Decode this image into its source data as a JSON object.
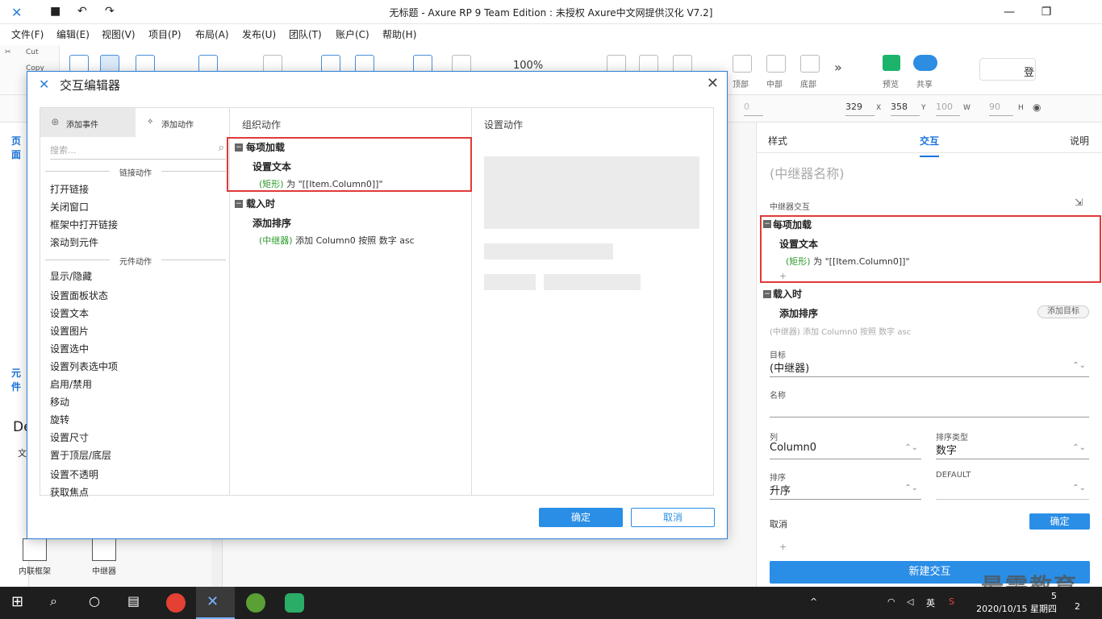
{
  "app": {
    "title": "无标题 - Axure RP 9 Team Edition : 未授权     Axure中文网提供汉化 V7.2]"
  },
  "menu": [
    "文件(F)",
    "编辑(E)",
    "视图(V)",
    "项目(P)",
    "布局(A)",
    "发布(U)",
    "团队(T)",
    "账户(C)",
    "帮助(H)"
  ],
  "clipboard": {
    "cut": "Cut",
    "copy": "Copy"
  },
  "toolbar": {
    "zoom": "100%",
    "align_labels": [
      "顶部",
      "中部",
      "底部"
    ],
    "preview": "预览",
    "share": "共享",
    "login": "登"
  },
  "stylebar": {
    "x": "329",
    "x_lbl": "X",
    "y": "358",
    "y_lbl": "Y",
    "w": "100",
    "w_lbl": "W",
    "h": "90",
    "h_lbl": "H",
    "zero": "0"
  },
  "left": {
    "pages_tab": "页面",
    "lib_tab": "元件",
    "lib_item1": "内联框架",
    "lib_item2": "中继器",
    "de": "De",
    "wen": "文"
  },
  "dialog": {
    "title": "交互编辑器",
    "tab_events": "添加事件",
    "tab_actions": "添加动作",
    "search_placeholder": "搜索...",
    "group_links": "链接动作",
    "link_actions": [
      "打开链接",
      "关闭窗口",
      "框架中打开链接",
      "滚动到元件"
    ],
    "group_widgets": "元件动作",
    "widget_actions": [
      "显示/隐藏",
      "设置面板状态",
      "设置文本",
      "设置图片",
      "设置选中",
      "设置列表选中项",
      "启用/禁用",
      "移动",
      "旋转",
      "设置尺寸",
      "置于顶层/底层",
      "设置不透明",
      "获取焦点"
    ],
    "organize_title": "组织动作",
    "configure_title": "设置动作",
    "event1": {
      "name": "每项加载",
      "action": "设置文本",
      "target": "(矩形)",
      "detail": " 为 \"[[Item.Column0]]\""
    },
    "event2": {
      "name": "载入时",
      "action": "添加排序",
      "target": "(中继器)",
      "detail": " 添加 Column0 按照 数字 asc"
    },
    "ok": "确定",
    "cancel": "取消"
  },
  "inspector": {
    "tabs": [
      "样式",
      "交互",
      "说明"
    ],
    "active_tab": "交互",
    "repeater_name": "(中继器名称)",
    "section": "中继器交互",
    "event1": {
      "name": "每项加载",
      "action": "设置文本",
      "target": "(矩形)",
      "detail": " 为 \"[[Item.Column0]]\""
    },
    "event2": {
      "name": "载入时",
      "action": "添加排序",
      "add_target": "添加目标",
      "summary": "(中继器) 添加 Column0 按照 数字 asc"
    },
    "target_lbl": "目标",
    "target_val": "(中继器)",
    "name_lbl": "名称",
    "column_lbl": "列",
    "column_val": "Column0",
    "sorttype_lbl": "排序类型",
    "sorttype_val": "数字",
    "order_lbl": "排序",
    "order_val": "升序",
    "default_lbl": "DEFAULT",
    "cancel": "取消",
    "ok": "确定",
    "new_interaction": "新建交互"
  },
  "taskbar": {
    "tray_lang": "英",
    "datetime": "2020/10/15 星期四",
    "time_frag": "5",
    "notif": "2"
  },
  "watermark": "最需教育",
  "colors": {
    "accent": "#2b8ee6",
    "highlight": "#e03a3a",
    "green": "#2a9a2a"
  }
}
